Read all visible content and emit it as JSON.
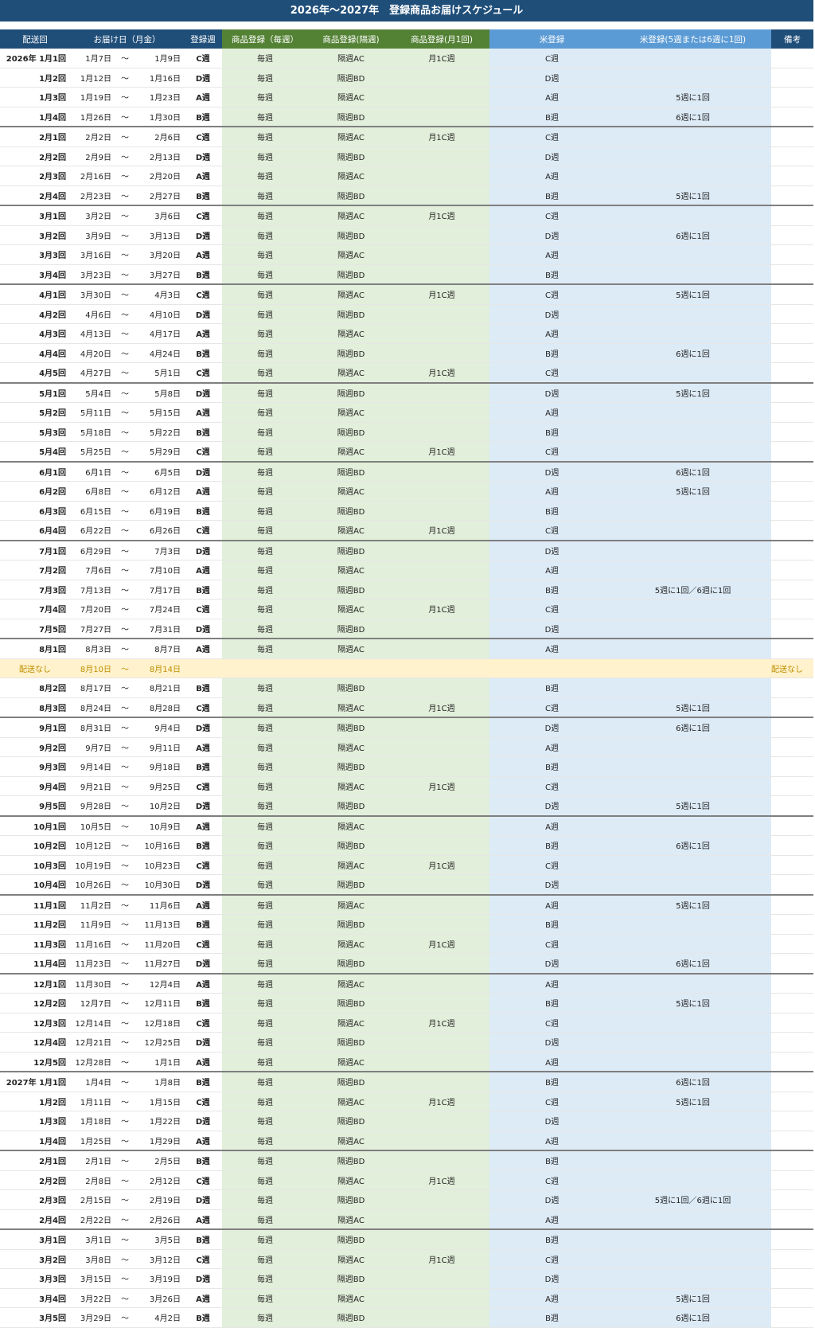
{
  "title": "2026年～2027年　登録商品お届けスケジュール",
  "headers": [
    "配送回",
    "お届け日（月金）",
    "登録週",
    "商品登録（毎週）",
    "商品登録(隔週)",
    "商品登録(月1回)",
    "米登録",
    "米登録(5週または6週に1回)",
    "備考"
  ],
  "rows": [
    {
      "round": "2026年 1月1回",
      "from": "1月7日",
      "tilde": "～",
      "to": "1月9日",
      "week": "C週",
      "weekly": "毎週",
      "biweekly": "隔週AC",
      "monthly": "月1C週",
      "rice": "C週",
      "rice_cycle": "",
      "note": ""
    },
    {
      "round": "1月2回",
      "from": "1月12日",
      "tilde": "～",
      "to": "1月16日",
      "week": "D週",
      "weekly": "毎週",
      "biweekly": "隔週BD",
      "monthly": "",
      "rice": "D週",
      "rice_cycle": "",
      "note": ""
    },
    {
      "round": "1月3回",
      "from": "1月19日",
      "tilde": "～",
      "to": "1月23日",
      "week": "A週",
      "weekly": "毎週",
      "biweekly": "隔週AC",
      "monthly": "",
      "rice": "A週",
      "rice_cycle": "5週に1回",
      "note": ""
    },
    {
      "round": "1月4回",
      "from": "1月26日",
      "tilde": "～",
      "to": "1月30日",
      "week": "B週",
      "weekly": "毎週",
      "biweekly": "隔週BD",
      "monthly": "",
      "rice": "B週",
      "rice_cycle": "6週に1回",
      "note": ""
    },
    {
      "round": "2月1回",
      "from": "2月2日",
      "tilde": "～",
      "to": "2月6日",
      "week": "C週",
      "weekly": "毎週",
      "biweekly": "隔週AC",
      "monthly": "月1C週",
      "rice": "C週",
      "rice_cycle": "",
      "note": ""
    },
    {
      "round": "2月2回",
      "from": "2月9日",
      "tilde": "～",
      "to": "2月13日",
      "week": "D週",
      "weekly": "毎週",
      "biweekly": "隔週BD",
      "monthly": "",
      "rice": "D週",
      "rice_cycle": "",
      "note": ""
    },
    {
      "round": "2月3回",
      "from": "2月16日",
      "tilde": "～",
      "to": "2月20日",
      "week": "A週",
      "weekly": "毎週",
      "biweekly": "隔週AC",
      "monthly": "",
      "rice": "A週",
      "rice_cycle": "",
      "note": ""
    },
    {
      "round": "2月4回",
      "from": "2月23日",
      "tilde": "～",
      "to": "2月27日",
      "week": "B週",
      "weekly": "毎週",
      "biweekly": "隔週BD",
      "monthly": "",
      "rice": "B週",
      "rice_cycle": "5週に1回",
      "note": ""
    },
    {
      "round": "3月1回",
      "from": "3月2日",
      "tilde": "～",
      "to": "3月6日",
      "week": "C週",
      "weekly": "毎週",
      "biweekly": "隔週AC",
      "monthly": "月1C週",
      "rice": "C週",
      "rice_cycle": "",
      "note": ""
    },
    {
      "round": "3月2回",
      "from": "3月9日",
      "tilde": "～",
      "to": "3月13日",
      "week": "D週",
      "weekly": "毎週",
      "biweekly": "隔週BD",
      "monthly": "",
      "rice": "D週",
      "rice_cycle": "6週に1回",
      "note": ""
    },
    {
      "round": "3月3回",
      "from": "3月16日",
      "tilde": "～",
      "to": "3月20日",
      "week": "A週",
      "weekly": "毎週",
      "biweekly": "隔週AC",
      "monthly": "",
      "rice": "A週",
      "rice_cycle": "",
      "note": ""
    },
    {
      "round": "3月4回",
      "from": "3月23日",
      "tilde": "～",
      "to": "3月27日",
      "week": "B週",
      "weekly": "毎週",
      "biweekly": "隔週BD",
      "monthly": "",
      "rice": "B週",
      "rice_cycle": "",
      "note": ""
    },
    {
      "round": "4月1回",
      "from": "3月30日",
      "tilde": "～",
      "to": "4月3日",
      "week": "C週",
      "weekly": "毎週",
      "biweekly": "隔週AC",
      "monthly": "月1C週",
      "rice": "C週",
      "rice_cycle": "5週に1回",
      "note": ""
    },
    {
      "round": "4月2回",
      "from": "4月6日",
      "tilde": "～",
      "to": "4月10日",
      "week": "D週",
      "weekly": "毎週",
      "biweekly": "隔週BD",
      "monthly": "",
      "rice": "D週",
      "rice_cycle": "",
      "note": ""
    },
    {
      "round": "4月3回",
      "from": "4月13日",
      "tilde": "～",
      "to": "4月17日",
      "week": "A週",
      "weekly": "毎週",
      "biweekly": "隔週AC",
      "monthly": "",
      "rice": "A週",
      "rice_cycle": "",
      "note": ""
    },
    {
      "round": "4月4回",
      "from": "4月20日",
      "tilde": "～",
      "to": "4月24日",
      "week": "B週",
      "weekly": "毎週",
      "biweekly": "隔週BD",
      "monthly": "",
      "rice": "B週",
      "rice_cycle": "6週に1回",
      "note": ""
    },
    {
      "round": "4月5回",
      "from": "4月27日",
      "tilde": "～",
      "to": "5月1日",
      "week": "C週",
      "weekly": "毎週",
      "biweekly": "隔週AC",
      "monthly": "月1C週",
      "rice": "C週",
      "rice_cycle": "",
      "note": ""
    },
    {
      "round": "5月1回",
      "from": "5月4日",
      "tilde": "～",
      "to": "5月8日",
      "week": "D週",
      "weekly": "毎週",
      "biweekly": "隔週BD",
      "monthly": "",
      "rice": "D週",
      "rice_cycle": "5週に1回",
      "note": ""
    },
    {
      "round": "5月2回",
      "from": "5月11日",
      "tilde": "～",
      "to": "5月15日",
      "week": "A週",
      "weekly": "毎週",
      "biweekly": "隔週AC",
      "monthly": "",
      "rice": "A週",
      "rice_cycle": "",
      "note": ""
    },
    {
      "round": "5月3回",
      "from": "5月18日",
      "tilde": "～",
      "to": "5月22日",
      "week": "B週",
      "weekly": "毎週",
      "biweekly": "隔週BD",
      "monthly": "",
      "rice": "B週",
      "rice_cycle": "",
      "note": ""
    },
    {
      "round": "5月4回",
      "from": "5月25日",
      "tilde": "～",
      "to": "5月29日",
      "week": "C週",
      "weekly": "毎週",
      "biweekly": "隔週AC",
      "monthly": "月1C週",
      "rice": "C週",
      "rice_cycle": "",
      "note": ""
    },
    {
      "round": "6月1回",
      "from": "6月1日",
      "tilde": "～",
      "to": "6月5日",
      "week": "D週",
      "weekly": "毎週",
      "biweekly": "隔週BD",
      "monthly": "",
      "rice": "D週",
      "rice_cycle": "6週に1回",
      "note": ""
    },
    {
      "round": "6月2回",
      "from": "6月8日",
      "tilde": "～",
      "to": "6月12日",
      "week": "A週",
      "weekly": "毎週",
      "biweekly": "隔週AC",
      "monthly": "",
      "rice": "A週",
      "rice_cycle": "5週に1回",
      "note": ""
    },
    {
      "round": "6月3回",
      "from": "6月15日",
      "tilde": "～",
      "to": "6月19日",
      "week": "B週",
      "weekly": "毎週",
      "biweekly": "隔週BD",
      "monthly": "",
      "rice": "B週",
      "rice_cycle": "",
      "note": ""
    },
    {
      "round": "6月4回",
      "from": "6月22日",
      "tilde": "～",
      "to": "6月26日",
      "week": "C週",
      "weekly": "毎週",
      "biweekly": "隔週AC",
      "monthly": "月1C週",
      "rice": "C週",
      "rice_cycle": "",
      "note": ""
    },
    {
      "round": "7月1回",
      "from": "6月29日",
      "tilde": "～",
      "to": "7月3日",
      "week": "D週",
      "weekly": "毎週",
      "biweekly": "隔週BD",
      "monthly": "",
      "rice": "D週",
      "rice_cycle": "",
      "note": ""
    },
    {
      "round": "7月2回",
      "from": "7月6日",
      "tilde": "～",
      "to": "7月10日",
      "week": "A週",
      "weekly": "毎週",
      "biweekly": "隔週AC",
      "monthly": "",
      "rice": "A週",
      "rice_cycle": "",
      "note": ""
    },
    {
      "round": "7月3回",
      "from": "7月13日",
      "tilde": "～",
      "to": "7月17日",
      "week": "B週",
      "weekly": "毎週",
      "biweekly": "隔週BD",
      "monthly": "",
      "rice": "B週",
      "rice_cycle": "5週に1回／6週に1回",
      "note": ""
    },
    {
      "round": "7月4回",
      "from": "7月20日",
      "tilde": "～",
      "to": "7月24日",
      "week": "C週",
      "weekly": "毎週",
      "biweekly": "隔週AC",
      "monthly": "月1C週",
      "rice": "C週",
      "rice_cycle": "",
      "note": ""
    },
    {
      "round": "7月5回",
      "from": "7月27日",
      "tilde": "～",
      "to": "7月31日",
      "week": "D週",
      "weekly": "毎週",
      "biweekly": "隔週BD",
      "monthly": "",
      "rice": "D週",
      "rice_cycle": "",
      "note": ""
    },
    {
      "round": "8月1回",
      "from": "8月3日",
      "tilde": "～",
      "to": "8月7日",
      "week": "A週",
      "weekly": "毎週",
      "biweekly": "隔週AC",
      "monthly": "",
      "rice": "A週",
      "rice_cycle": "",
      "note": ""
    },
    {
      "round": "配送なし",
      "from": "8月10日",
      "tilde": "～",
      "to": "8月14日",
      "week": "",
      "weekly": "",
      "biweekly": "",
      "monthly": "",
      "rice": "",
      "rice_cycle": "",
      "note": "配送なし",
      "no_delivery": true
    },
    {
      "round": "8月2回",
      "from": "8月17日",
      "tilde": "～",
      "to": "8月21日",
      "week": "B週",
      "weekly": "毎週",
      "biweekly": "隔週BD",
      "monthly": "",
      "rice": "B週",
      "rice_cycle": "",
      "note": ""
    },
    {
      "round": "8月3回",
      "from": "8月24日",
      "tilde": "～",
      "to": "8月28日",
      "week": "C週",
      "weekly": "毎週",
      "biweekly": "隔週AC",
      "monthly": "月1C週",
      "rice": "C週",
      "rice_cycle": "5週に1回",
      "note": ""
    },
    {
      "round": "9月1回",
      "from": "8月31日",
      "tilde": "～",
      "to": "9月4日",
      "week": "D週",
      "weekly": "毎週",
      "biweekly": "隔週BD",
      "monthly": "",
      "rice": "D週",
      "rice_cycle": "6週に1回",
      "note": ""
    },
    {
      "round": "9月2回",
      "from": "9月7日",
      "tilde": "～",
      "to": "9月11日",
      "week": "A週",
      "weekly": "毎週",
      "biweekly": "隔週AC",
      "monthly": "",
      "rice": "A週",
      "rice_cycle": "",
      "note": ""
    },
    {
      "round": "9月3回",
      "from": "9月14日",
      "tilde": "～",
      "to": "9月18日",
      "week": "B週",
      "weekly": "毎週",
      "biweekly": "隔週BD",
      "monthly": "",
      "rice": "B週",
      "rice_cycle": "",
      "note": ""
    },
    {
      "round": "9月4回",
      "from": "9月21日",
      "tilde": "～",
      "to": "9月25日",
      "week": "C週",
      "weekly": "毎週",
      "biweekly": "隔週AC",
      "monthly": "月1C週",
      "rice": "C週",
      "rice_cycle": "",
      "note": ""
    },
    {
      "round": "9月5回",
      "from": "9月28日",
      "tilde": "～",
      "to": "10月2日",
      "week": "D週",
      "weekly": "毎週",
      "biweekly": "隔週BD",
      "monthly": "",
      "rice": "D週",
      "rice_cycle": "5週に1回",
      "note": ""
    },
    {
      "round": "10月1回",
      "from": "10月5日",
      "tilde": "～",
      "to": "10月9日",
      "week": "A週",
      "weekly": "毎週",
      "biweekly": "隔週AC",
      "monthly": "",
      "rice": "A週",
      "rice_cycle": "",
      "note": ""
    },
    {
      "round": "10月2回",
      "from": "10月12日",
      "tilde": "～",
      "to": "10月16日",
      "week": "B週",
      "weekly": "毎週",
      "biweekly": "隔週BD",
      "monthly": "",
      "rice": "B週",
      "rice_cycle": "6週に1回",
      "note": ""
    },
    {
      "round": "10月3回",
      "from": "10月19日",
      "tilde": "～",
      "to": "10月23日",
      "week": "C週",
      "weekly": "毎週",
      "biweekly": "隔週AC",
      "monthly": "月1C週",
      "rice": "C週",
      "rice_cycle": "",
      "note": ""
    },
    {
      "round": "10月4回",
      "from": "10月26日",
      "tilde": "～",
      "to": "10月30日",
      "week": "D週",
      "weekly": "毎週",
      "biweekly": "隔週BD",
      "monthly": "",
      "rice": "D週",
      "rice_cycle": "",
      "note": ""
    },
    {
      "round": "11月1回",
      "from": "11月2日",
      "tilde": "～",
      "to": "11月6日",
      "week": "A週",
      "weekly": "毎週",
      "biweekly": "隔週AC",
      "monthly": "",
      "rice": "A週",
      "rice_cycle": "5週に1回",
      "note": ""
    },
    {
      "round": "11月2回",
      "from": "11月9日",
      "tilde": "～",
      "to": "11月13日",
      "week": "B週",
      "weekly": "毎週",
      "biweekly": "隔週BD",
      "monthly": "",
      "rice": "B週",
      "rice_cycle": "",
      "note": ""
    },
    {
      "round": "11月3回",
      "from": "11月16日",
      "tilde": "～",
      "to": "11月20日",
      "week": "C週",
      "weekly": "毎週",
      "biweekly": "隔週AC",
      "monthly": "月1C週",
      "rice": "C週",
      "rice_cycle": "",
      "note": ""
    },
    {
      "round": "11月4回",
      "from": "11月23日",
      "tilde": "～",
      "to": "11月27日",
      "week": "D週",
      "weekly": "毎週",
      "biweekly": "隔週BD",
      "monthly": "",
      "rice": "D週",
      "rice_cycle": "6週に1回",
      "note": ""
    },
    {
      "round": "12月1回",
      "from": "11月30日",
      "tilde": "～",
      "to": "12月4日",
      "week": "A週",
      "weekly": "毎週",
      "biweekly": "隔週AC",
      "monthly": "",
      "rice": "A週",
      "rice_cycle": "",
      "note": ""
    },
    {
      "round": "12月2回",
      "from": "12月7日",
      "tilde": "～",
      "to": "12月11日",
      "week": "B週",
      "weekly": "毎週",
      "biweekly": "隔週BD",
      "monthly": "",
      "rice": "B週",
      "rice_cycle": "5週に1回",
      "note": ""
    },
    {
      "round": "12月3回",
      "from": "12月14日",
      "tilde": "～",
      "to": "12月18日",
      "week": "C週",
      "weekly": "毎週",
      "biweekly": "隔週AC",
      "monthly": "月1C週",
      "rice": "C週",
      "rice_cycle": "",
      "note": ""
    },
    {
      "round": "12月4回",
      "from": "12月21日",
      "tilde": "～",
      "to": "12月25日",
      "week": "D週",
      "weekly": "毎週",
      "biweekly": "隔週BD",
      "monthly": "",
      "rice": "D週",
      "rice_cycle": "",
      "note": ""
    },
    {
      "round": "12月5回",
      "from": "12月28日",
      "tilde": "～",
      "to": "1月1日",
      "week": "A週",
      "weekly": "毎週",
      "biweekly": "隔週AC",
      "monthly": "",
      "rice": "A週",
      "rice_cycle": "",
      "note": ""
    },
    {
      "round": "2027年 1月1回",
      "from": "1月4日",
      "tilde": "～",
      "to": "1月8日",
      "week": "B週",
      "weekly": "毎週",
      "biweekly": "隔週BD",
      "monthly": "",
      "rice": "B週",
      "rice_cycle": "6週に1回",
      "note": ""
    },
    {
      "round": "1月2回",
      "from": "1月11日",
      "tilde": "～",
      "to": "1月15日",
      "week": "C週",
      "weekly": "毎週",
      "biweekly": "隔週AC",
      "monthly": "月1C週",
      "rice": "C週",
      "rice_cycle": "5週に1回",
      "note": ""
    },
    {
      "round": "1月3回",
      "from": "1月18日",
      "tilde": "～",
      "to": "1月22日",
      "week": "D週",
      "weekly": "毎週",
      "biweekly": "隔週BD",
      "monthly": "",
      "rice": "D週",
      "rice_cycle": "",
      "note": ""
    },
    {
      "round": "1月4回",
      "from": "1月25日",
      "tilde": "～",
      "to": "1月29日",
      "week": "A週",
      "weekly": "毎週",
      "biweekly": "隔週AC",
      "monthly": "",
      "rice": "A週",
      "rice_cycle": "",
      "note": ""
    },
    {
      "round": "2月1回",
      "from": "2月1日",
      "tilde": "～",
      "to": "2月5日",
      "week": "B週",
      "weekly": "毎週",
      "biweekly": "隔週BD",
      "monthly": "",
      "rice": "B週",
      "rice_cycle": "",
      "note": ""
    },
    {
      "round": "2月2回",
      "from": "2月8日",
      "tilde": "～",
      "to": "2月12日",
      "week": "C週",
      "weekly": "毎週",
      "biweekly": "隔週AC",
      "monthly": "月1C週",
      "rice": "C週",
      "rice_cycle": "",
      "note": ""
    },
    {
      "round": "2月3回",
      "from": "2月15日",
      "tilde": "～",
      "to": "2月19日",
      "week": "D週",
      "weekly": "毎週",
      "biweekly": "隔週BD",
      "monthly": "",
      "rice": "D週",
      "rice_cycle": "5週に1回／6週に1回",
      "note": ""
    },
    {
      "round": "2月4回",
      "from": "2月22日",
      "tilde": "～",
      "to": "2月26日",
      "week": "A週",
      "weekly": "毎週",
      "biweekly": "隔週AC",
      "monthly": "",
      "rice": "A週",
      "rice_cycle": "",
      "note": ""
    },
    {
      "round": "3月1回",
      "from": "3月1日",
      "tilde": "～",
      "to": "3月5日",
      "week": "B週",
      "weekly": "毎週",
      "biweekly": "隔週BD",
      "monthly": "",
      "rice": "B週",
      "rice_cycle": "",
      "note": ""
    },
    {
      "round": "3月2回",
      "from": "3月8日",
      "tilde": "～",
      "to": "3月12日",
      "week": "C週",
      "weekly": "毎週",
      "biweekly": "隔週AC",
      "monthly": "月1C週",
      "rice": "C週",
      "rice_cycle": "",
      "note": ""
    },
    {
      "round": "3月3回",
      "from": "3月15日",
      "tilde": "～",
      "to": "3月19日",
      "week": "D週",
      "weekly": "毎週",
      "biweekly": "隔週BD",
      "monthly": "",
      "rice": "D週",
      "rice_cycle": "",
      "note": ""
    },
    {
      "round": "3月4回",
      "from": "3月22日",
      "tilde": "～",
      "to": "3月26日",
      "week": "A週",
      "weekly": "毎週",
      "biweekly": "隔週AC",
      "monthly": "",
      "rice": "A週",
      "rice_cycle": "5週に1回",
      "note": ""
    },
    {
      "round": "3月5回",
      "from": "3月29日",
      "tilde": "～",
      "to": "4月2日",
      "week": "B週",
      "weekly": "毎週",
      "biweekly": "隔週BD",
      "monthly": "",
      "rice": "B週",
      "rice_cycle": "6週に1回",
      "note": ""
    }
  ]
}
